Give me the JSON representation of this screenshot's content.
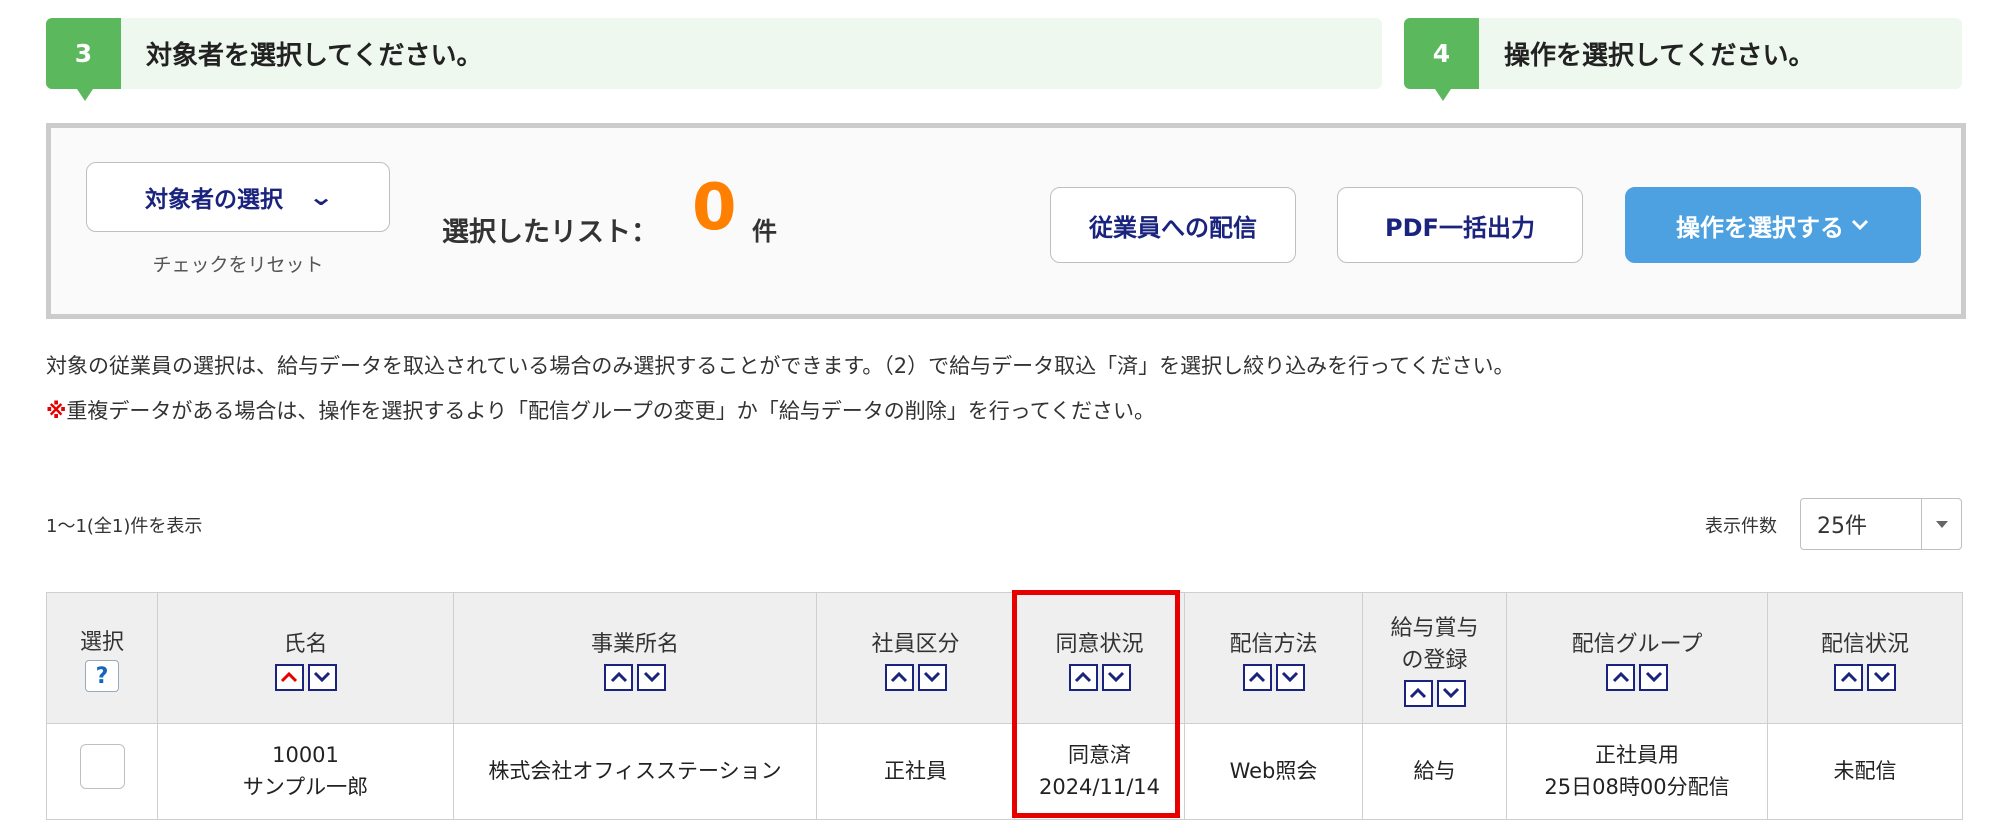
{
  "steps": [
    {
      "number": "3",
      "text": "対象者を選択してください。"
    },
    {
      "number": "4",
      "text": "操作を選択してください。"
    }
  ],
  "operation": {
    "target_select_label": "対象者の選択",
    "reset_label": "チェックをリセット",
    "selected_list_label": "選択したリスト：",
    "selected_count": "0",
    "selected_unit": "件",
    "distribute_button": "従業員への配信",
    "pdf_button": "PDF一括出力",
    "action_button": "操作を選択する"
  },
  "notes": {
    "line1": "対象の従業員の選択は、給与データを取込されている場合のみ選択することができます。（2）で給与データ取込「済」を選択し絞り込みを行ってください。",
    "line2_mark": "※",
    "line2": "重複データがある場合は、操作を選択するより「配信グループの変更」か「給与データの削除」を行ってください。"
  },
  "pagination": {
    "count_text": "1～1(全1)件を表示",
    "per_page_label": "表示件数",
    "per_page_value": "25件"
  },
  "table": {
    "headers": {
      "select": "選択",
      "help": "?",
      "name": "氏名",
      "office": "事業所名",
      "employee_type": "社員区分",
      "consent": "同意状況",
      "delivery_method": "配信方法",
      "registration_line1": "給与賞与",
      "registration_line2": "の登録",
      "delivery_group": "配信グループ",
      "delivery_status": "配信状況"
    },
    "rows": [
      {
        "employee_id": "10001",
        "employee_name": "サンプル一郎",
        "office": "株式会社オフィスステーション",
        "employee_type": "正社員",
        "consent_status": "同意済",
        "consent_date": "2024/11/14",
        "delivery_method": "Web照会",
        "registration": "給与",
        "group_name": "正社員用",
        "group_schedule": "25日08時00分配信",
        "delivery_status": "未配信"
      }
    ]
  },
  "colors": {
    "step_green": "#5cb85c",
    "count_orange": "#ff7f00",
    "primary_blue": "#4da1e0",
    "navy": "#1a237e",
    "highlight_red": "#e60000"
  }
}
